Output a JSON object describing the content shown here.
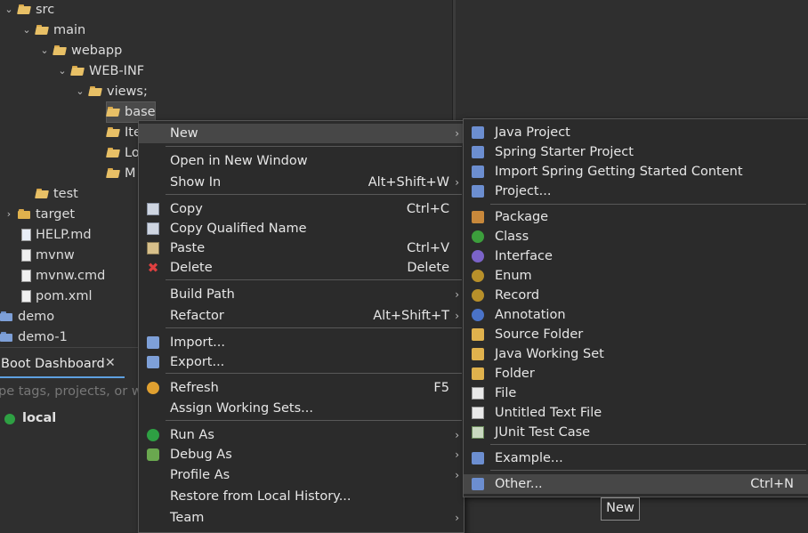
{
  "tree": {
    "items": [
      {
        "label": "src",
        "kind": "folder-open"
      },
      {
        "label": "main",
        "kind": "folder-open"
      },
      {
        "label": "webapp",
        "kind": "folder-open"
      },
      {
        "label": "WEB-INF",
        "kind": "folder-open"
      },
      {
        "label": "views;",
        "kind": "folder-open"
      },
      {
        "label": "base",
        "kind": "folder-open"
      },
      {
        "label": "Ite",
        "kind": "folder-open"
      },
      {
        "label": "Lo",
        "kind": "folder-open"
      },
      {
        "label": "M",
        "kind": "folder-open"
      },
      {
        "label": "test",
        "kind": "folder-open"
      },
      {
        "label": "target",
        "kind": "folder"
      },
      {
        "label": "HELP.md",
        "kind": "file"
      },
      {
        "label": "mvnw",
        "kind": "file"
      },
      {
        "label": "mvnw.cmd",
        "kind": "file"
      },
      {
        "label": "pom.xml",
        "kind": "file"
      },
      {
        "label": "demo",
        "kind": "project"
      },
      {
        "label": "demo-1",
        "kind": "project"
      }
    ]
  },
  "boot_dashboard": {
    "tab_label": "Boot Dashboard",
    "close_glyph": "✕",
    "filter_placeholder": "pe tags, projects, or wo",
    "local_label": "local"
  },
  "context_menu": {
    "items": [
      {
        "label": "New",
        "accel": "",
        "submenu": true,
        "icon": "",
        "highlight": true
      },
      {
        "sep": true
      },
      {
        "label": "Open in New Window",
        "accel": "",
        "submenu": false,
        "icon": ""
      },
      {
        "label": "Show In",
        "accel": "Alt+Shift+W",
        "submenu": true,
        "icon": ""
      },
      {
        "sep": true
      },
      {
        "label": "Copy",
        "accel": "Ctrl+C",
        "submenu": false,
        "icon": "copy"
      },
      {
        "label": "Copy Qualified Name",
        "accel": "",
        "submenu": false,
        "icon": "copy"
      },
      {
        "label": "Paste",
        "accel": "Ctrl+V",
        "submenu": false,
        "icon": "paste"
      },
      {
        "label": "Delete",
        "accel": "Delete",
        "submenu": false,
        "icon": "red"
      },
      {
        "sep": true
      },
      {
        "label": "Build Path",
        "accel": "",
        "submenu": true,
        "icon": ""
      },
      {
        "label": "Refactor",
        "accel": "Alt+Shift+T",
        "submenu": true,
        "icon": ""
      },
      {
        "sep": true
      },
      {
        "label": "Import...",
        "accel": "",
        "submenu": false,
        "icon": "imp"
      },
      {
        "label": "Export...",
        "accel": "",
        "submenu": false,
        "icon": "imp"
      },
      {
        "sep": true
      },
      {
        "label": "Refresh",
        "accel": "F5",
        "submenu": false,
        "icon": "ref"
      },
      {
        "label": "Assign Working Sets...",
        "accel": "",
        "submenu": false,
        "icon": ""
      },
      {
        "sep": true
      },
      {
        "label": "Run As",
        "accel": "",
        "submenu": true,
        "icon": "run"
      },
      {
        "label": "Debug As",
        "accel": "",
        "submenu": true,
        "icon": "dbg"
      },
      {
        "label": "Profile As",
        "accel": "",
        "submenu": true,
        "icon": ""
      },
      {
        "label": "Restore from Local History...",
        "accel": "",
        "submenu": false,
        "icon": ""
      },
      {
        "label": "Team",
        "accel": "",
        "submenu": true,
        "icon": ""
      }
    ]
  },
  "submenu": {
    "items": [
      {
        "label": "Java Project",
        "icon": "proj"
      },
      {
        "label": "Spring Starter Project",
        "icon": "proj"
      },
      {
        "label": "Import Spring Getting Started Content",
        "icon": "proj"
      },
      {
        "label": "Project...",
        "icon": "proj"
      },
      {
        "sep": true
      },
      {
        "label": "Package",
        "icon": "pkg"
      },
      {
        "label": "Class",
        "icon": "cls"
      },
      {
        "label": "Interface",
        "icon": "itf"
      },
      {
        "label": "Enum",
        "icon": "enm"
      },
      {
        "label": "Record",
        "icon": "rec"
      },
      {
        "label": "Annotation",
        "icon": "ann"
      },
      {
        "label": "Source Folder",
        "icon": "fold"
      },
      {
        "label": "Java Working Set",
        "icon": "fold"
      },
      {
        "label": "Folder",
        "icon": "fold"
      },
      {
        "label": "File",
        "icon": "file"
      },
      {
        "label": "Untitled Text File",
        "icon": "file"
      },
      {
        "label": "JUnit Test Case",
        "icon": "junit"
      },
      {
        "sep": true
      },
      {
        "label": "Example...",
        "icon": "proj"
      },
      {
        "sep": true
      },
      {
        "label": "Other...",
        "icon": "proj",
        "accel": "Ctrl+N",
        "highlight": true
      }
    ]
  },
  "tooltip": "New"
}
